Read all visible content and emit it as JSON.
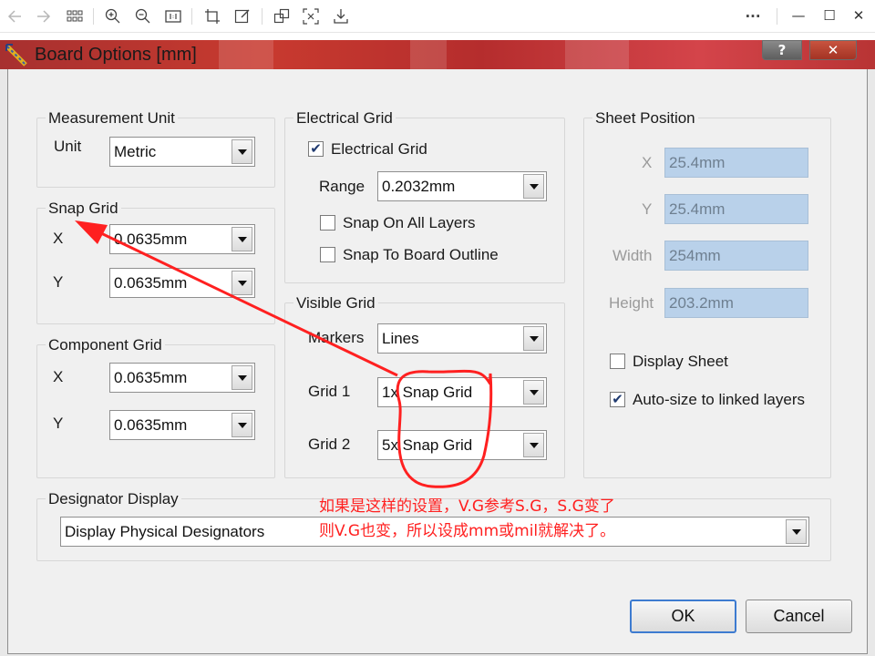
{
  "viewer": {
    "toolbar_icons": [
      "back-arrow-icon",
      "forward-arrow-icon",
      "grid-view-icon",
      "zoom-in-icon",
      "zoom-out-icon",
      "actual-size-icon",
      "crop-icon",
      "edit-icon",
      "copy-icon",
      "fullscreen-icon",
      "save-icon",
      "more-icon",
      "minimize-icon",
      "maximize-icon",
      "close-icon"
    ],
    "more": "···",
    "minimize": "—",
    "maximize": "☐",
    "close": "✕"
  },
  "dialog": {
    "title": "Board Options [mm]",
    "help_label": "?",
    "close_label": "✕",
    "title_bar_color": "#b52d2d"
  },
  "measurement_unit": {
    "legend": "Measurement Unit",
    "unit_label": "Unit",
    "unit_value": "Metric"
  },
  "snap_grid": {
    "legend": "Snap Grid",
    "x_label": "X",
    "x_value": "0.0635mm",
    "y_label": "Y",
    "y_value": "0.0635mm"
  },
  "component_grid": {
    "legend": "Component Grid",
    "x_label": "X",
    "x_value": "0.0635mm",
    "y_label": "Y",
    "y_value": "0.0635mm"
  },
  "electrical_grid": {
    "legend": "Electrical Grid",
    "enable_label": "Electrical Grid",
    "enable_checked": true,
    "range_label": "Range",
    "range_value": "0.2032mm",
    "snap_all_layers_label": "Snap On All Layers",
    "snap_all_layers_checked": false,
    "snap_board_outline_label": "Snap To Board Outline",
    "snap_board_outline_checked": false
  },
  "visible_grid": {
    "legend": "Visible Grid",
    "markers_label": "Markers",
    "markers_value": "Lines",
    "grid1_label": "Grid 1",
    "grid1_value": "1x Snap Grid",
    "grid2_label": "Grid 2",
    "grid2_value": "5x Snap Grid"
  },
  "sheet_position": {
    "legend": "Sheet Position",
    "x_label": "X",
    "x_value": "25.4mm",
    "y_label": "Y",
    "y_value": "25.4mm",
    "width_label": "Width",
    "width_value": "254mm",
    "height_label": "Height",
    "height_value": "203.2mm",
    "display_sheet_label": "Display Sheet",
    "display_sheet_checked": false,
    "autosize_label": "Auto-size to linked layers",
    "autosize_checked": true
  },
  "designator_display": {
    "legend": "Designator Display",
    "value": "Display Physical Designators"
  },
  "buttons": {
    "ok": "OK",
    "cancel": "Cancel"
  },
  "annotation": {
    "line1": "如果是这样的设置，V.G参考S.G，S.G变了",
    "line2": "则V.G也变，所以设成mm或mil就解决了。",
    "color": "#ff2020"
  }
}
